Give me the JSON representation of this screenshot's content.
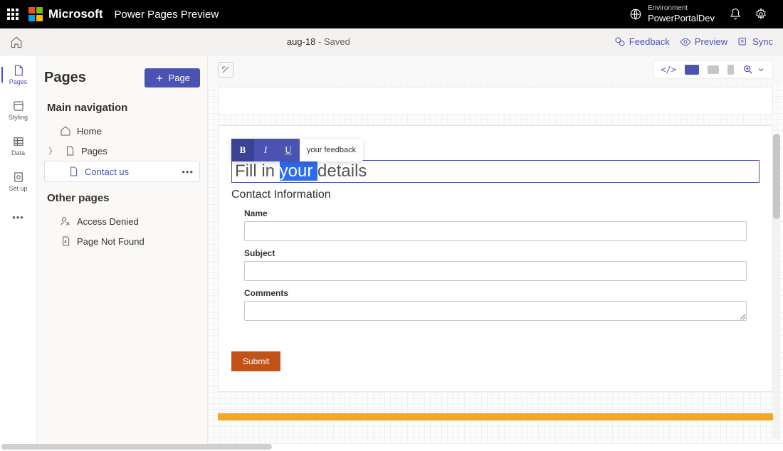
{
  "topbar": {
    "brand": "Microsoft",
    "product": "Power Pages Preview",
    "env_label": "Environment",
    "env_name": "PowerPortalDev"
  },
  "cmdbar": {
    "doc_name": "aug-18",
    "status": " - Saved",
    "feedback": "Feedback",
    "preview": "Preview",
    "sync": "Sync"
  },
  "rail": {
    "pages": "Pages",
    "styling": "Styling",
    "data": "Data",
    "setup": "Set up"
  },
  "sidebar": {
    "title": "Pages",
    "add_page_btn": "Page",
    "section_main": "Main navigation",
    "items": {
      "home": "Home",
      "pages": "Pages",
      "contact": "Contact us"
    },
    "section_other": "Other pages",
    "other_items": {
      "denied": "Access Denied",
      "notfound": "Page Not Found"
    }
  },
  "canvas": {
    "popup_tail": "your feedback",
    "heading_pre": "Fill in ",
    "heading_sel": "your ",
    "heading_post": "details",
    "subheading": "Contact Information",
    "fields": {
      "name": "Name",
      "subject": "Subject",
      "comments": "Comments"
    },
    "submit": "Submit"
  }
}
